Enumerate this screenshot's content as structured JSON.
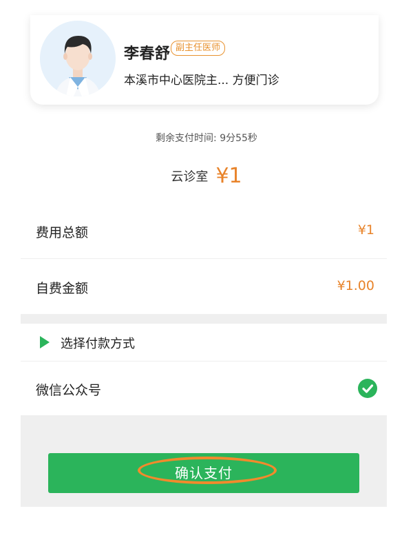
{
  "doctor": {
    "name": "李春舒",
    "title": "副主任医师",
    "hospital": "本溪市中心医院主...  方便门诊"
  },
  "payment": {
    "timer_text": "剩余支付时间:  9分55秒",
    "service_label": "云诊室",
    "service_price": "¥1"
  },
  "fees": [
    {
      "label": "费用总额",
      "value": "¥1"
    },
    {
      "label": "自费金额",
      "value": "¥1.00"
    }
  ],
  "method": {
    "header_label": "选择付款方式",
    "option_label": "微信公众号",
    "option_selected": true
  },
  "actions": {
    "confirm_label": "确认支付"
  },
  "colors": {
    "accent_orange": "#e8832a",
    "brand_green": "#2bb45b",
    "highlight_orange": "#f28a2c"
  },
  "icons": {
    "avatar": "doctor-avatar",
    "method_indicator": "triangle-right-icon",
    "selected": "check-circle-icon"
  }
}
